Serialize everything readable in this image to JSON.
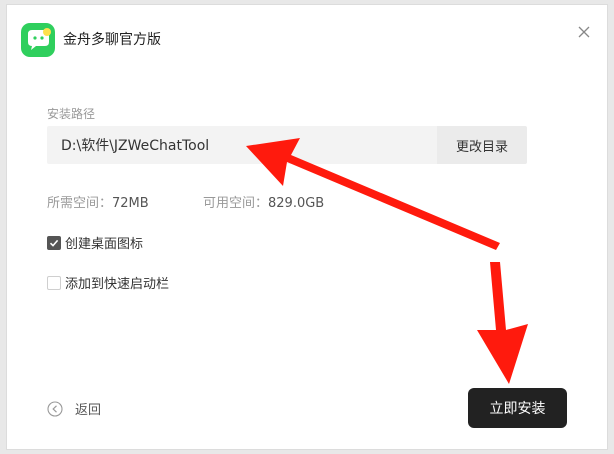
{
  "app": {
    "title": "金舟多聊官方版",
    "logo_icon": "chat-bubble-logo-icon",
    "brand_color": "#2fcf5d"
  },
  "install": {
    "path_label": "安装路径",
    "path_value": "D:\\软件\\JZWeChatTool",
    "change_dir_label": "更改目录",
    "required_space_label": "所需空间：",
    "required_space_value": "72MB",
    "available_space_label": "可用空间：",
    "available_space_value": "829.0GB",
    "options": [
      {
        "label": "创建桌面图标",
        "checked": true
      },
      {
        "label": "添加到快速启动栏",
        "checked": false
      }
    ]
  },
  "footer": {
    "back_label": "返回",
    "install_label": "立即安装",
    "install_button_color": "#222222"
  },
  "annotation": {
    "arrow_color": "#ff1a0d"
  }
}
